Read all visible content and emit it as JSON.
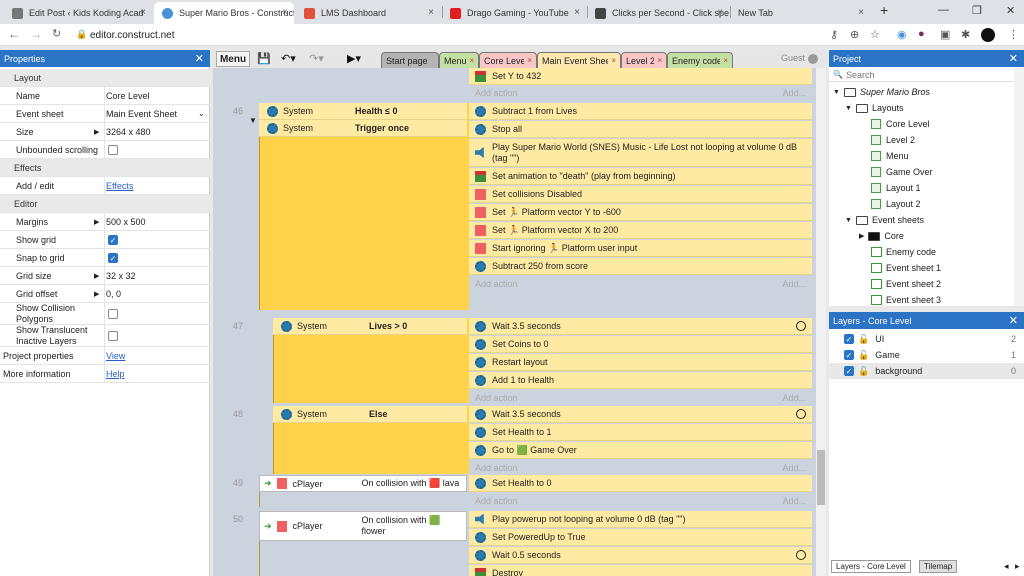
{
  "browser": {
    "tabs": [
      {
        "title": "Edit Post ‹ Kids Koding Acad",
        "color": "#777777"
      },
      {
        "title": "Super Mario Bros - Construct",
        "color": "#4a90d9"
      },
      {
        "title": "LMS Dashboard",
        "color": "#e0533a"
      },
      {
        "title": "Drago Gaming - YouTube",
        "color": "#e02020"
      },
      {
        "title": "Clicks per Second - Click spe",
        "color": "#444444"
      },
      {
        "title": "New Tab",
        "color": "#dddddd"
      }
    ],
    "url": "editor.construct.net"
  },
  "properties": {
    "title": "Properties",
    "rows": [
      {
        "type": "section",
        "label": "Layout"
      },
      {
        "type": "text",
        "label": "Name",
        "value": "Core Level"
      },
      {
        "type": "select",
        "label": "Event sheet",
        "value": "Main Event Sheet"
      },
      {
        "type": "expand",
        "label": "Size",
        "value": "3264 x 480"
      },
      {
        "type": "check",
        "label": "Unbounded scrolling",
        "checked": false
      },
      {
        "type": "section",
        "label": "Effects"
      },
      {
        "type": "link",
        "label": "Add / edit",
        "value": "Effects"
      },
      {
        "type": "section",
        "label": "Editor"
      },
      {
        "type": "expand",
        "label": "Margins",
        "value": "500 x 500"
      },
      {
        "type": "check",
        "label": "Show grid",
        "checked": true
      },
      {
        "type": "check",
        "label": "Snap to grid",
        "checked": true
      },
      {
        "type": "expand",
        "label": "Grid size",
        "value": "32 x 32"
      },
      {
        "type": "expand",
        "label": "Grid offset",
        "value": "0, 0"
      },
      {
        "type": "check2",
        "label": "Show Collision Polygons",
        "checked": false
      },
      {
        "type": "check2",
        "label": "Show Translucent Inactive Layers",
        "checked": false
      },
      {
        "type": "toplink",
        "label": "Project properties",
        "value": "View"
      },
      {
        "type": "toplink",
        "label": "More information",
        "value": "Help"
      }
    ]
  },
  "editor": {
    "menu_label": "Menu",
    "tabs": [
      "Start page",
      "Menu",
      "Core Level",
      "Main Event Sheet",
      "Level 2",
      "Enemy code"
    ],
    "guest": "Guest",
    "add_action": "Add action",
    "add_more": "Add...",
    "top_action": "Set Y to 432",
    "events": [
      {
        "num": "46",
        "conditions": [
          {
            "object": "System",
            "text": "Health ≤ 0"
          },
          {
            "object": "System",
            "text": "Trigger once"
          }
        ],
        "actions": [
          {
            "icon": "gear",
            "text": "Subtract 1 from Lives"
          },
          {
            "icon": "gear",
            "text": "Stop all"
          },
          {
            "icon": "speaker",
            "text": "Play Super Mario World (SNES) Music - Life Lost not looping at volume 0 dB (tag \"\")"
          },
          {
            "icon": "mario",
            "text": "Set animation to \"death\" (play from beginning)"
          },
          {
            "icon": "red",
            "text": "Set collisions Disabled"
          },
          {
            "icon": "red",
            "text": "Set 🏃 Platform vector Y to -600"
          },
          {
            "icon": "red",
            "text": "Set 🏃 Platform vector X to 200"
          },
          {
            "icon": "red",
            "text": "Start ignoring 🏃 Platform user input"
          },
          {
            "icon": "gear",
            "text": "Subtract 250 from score"
          }
        ]
      },
      {
        "num": "47",
        "conditions": [
          {
            "object": "System",
            "text": "Lives > 0"
          }
        ],
        "actions": [
          {
            "icon": "gear",
            "text": "Wait 3.5 seconds",
            "clock": true
          },
          {
            "icon": "gear",
            "text": "Set Coins to 0"
          },
          {
            "icon": "gear",
            "text": "Restart layout"
          },
          {
            "icon": "gear",
            "text": "Add 1 to Health"
          }
        ]
      },
      {
        "num": "48",
        "conditions": [
          {
            "object": "System",
            "text": "Else"
          }
        ],
        "actions": [
          {
            "icon": "gear",
            "text": "Wait 3.5 seconds",
            "clock": true
          },
          {
            "icon": "gear",
            "text": "Set Health to 1"
          },
          {
            "icon": "gear",
            "text": "Go to 🟩 Game Over"
          }
        ]
      },
      {
        "num": "49",
        "conditions": [
          {
            "object": "cPlayer",
            "text": "On collision with 🟥 lava"
          }
        ],
        "actions": [
          {
            "icon": "gear",
            "text": "Set Health to 0"
          }
        ]
      },
      {
        "num": "50",
        "conditions": [
          {
            "object": "cPlayer",
            "text": "On collision with 🟩 flower"
          }
        ],
        "actions": [
          {
            "icon": "speaker",
            "text": "Play powerup not looping at volume 0 dB (tag \"\")"
          },
          {
            "icon": "gear",
            "text": "Set PoweredUp to True"
          },
          {
            "icon": "gear",
            "text": "Wait 0.5 seconds",
            "clock": true
          },
          {
            "icon": "mario",
            "text": "Destroy"
          }
        ]
      }
    ]
  },
  "project": {
    "title": "Project",
    "search_placeholder": "Search",
    "root": "Super Mario Bros",
    "layouts_label": "Layouts",
    "layouts": [
      "Core Level",
      "Level 2",
      "Menu",
      "Game Over",
      "Layout 1",
      "Layout 2"
    ],
    "eventsheets_label": "Event sheets",
    "eventsheets": [
      "Core",
      "Enemy code",
      "Event sheet 1",
      "Event sheet 2",
      "Event sheet 3"
    ]
  },
  "layers": {
    "title": "Layers - Core Level",
    "items": [
      {
        "name": "UI",
        "index": "2"
      },
      {
        "name": "Game",
        "index": "1"
      },
      {
        "name": "background",
        "index": "0"
      }
    ],
    "bottom_tabs": [
      "Layers - Core Level",
      "Tilemap"
    ]
  }
}
